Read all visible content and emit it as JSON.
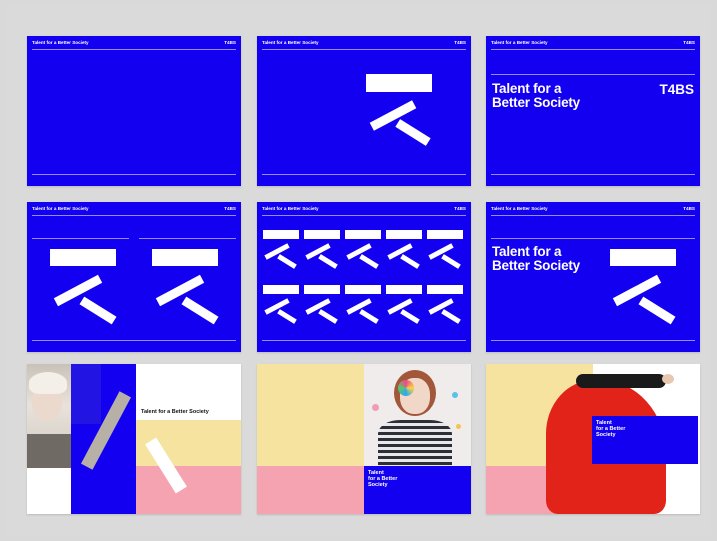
{
  "brand": {
    "name": "Talent for a Better Society",
    "abbr": "T4BS",
    "title_lines": [
      "Talent for a",
      "Better Society"
    ],
    "stacked_lines": [
      "Talent",
      "for a Better",
      "Society"
    ]
  },
  "colors": {
    "brand_blue": "#1400f0",
    "pale_yellow": "#f6e3a0",
    "pink": "#f5a3b0",
    "red": "#e2231a",
    "white": "#ffffff"
  }
}
